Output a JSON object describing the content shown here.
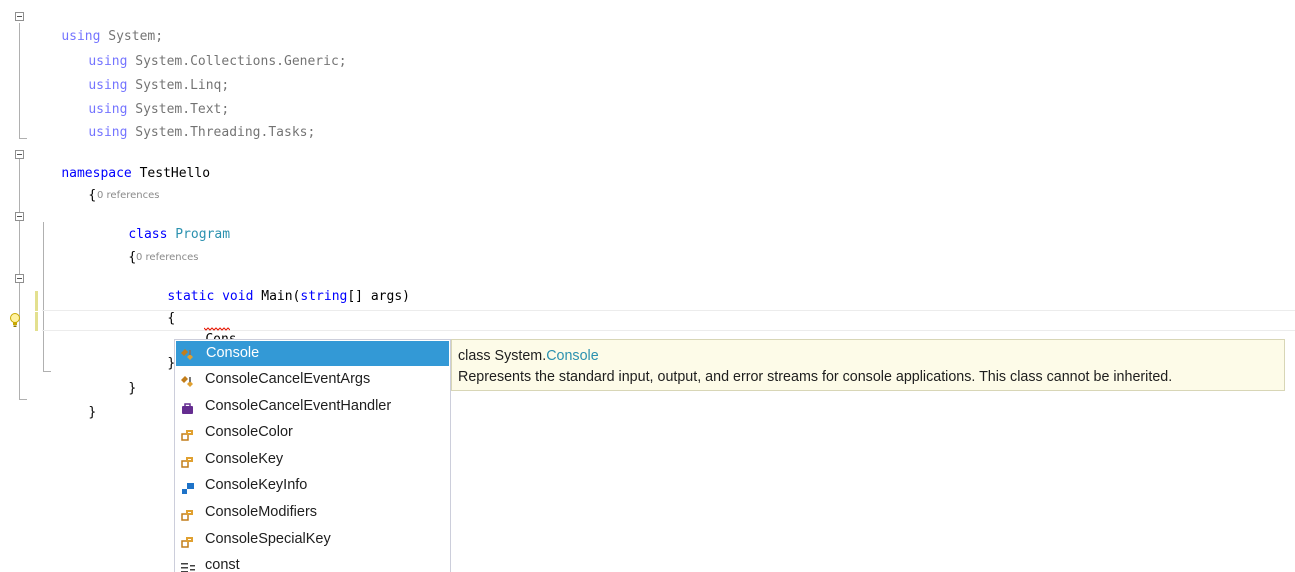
{
  "code": {
    "using1_kw": "using",
    "using1_ns": " System;",
    "using2_kw": "using",
    "using2_ns": " System.Collections.Generic;",
    "using3_kw": "using",
    "using3_ns": " System.Linq;",
    "using4_kw": "using",
    "using4_ns": " System.Text;",
    "using5_kw": "using",
    "using5_ns": " System.Threading.Tasks;",
    "ns_kw": "namespace",
    "ns_name": " TestHello",
    "open_brace": "{",
    "close_brace": "}",
    "class_kw": "class",
    "class_name": " Program",
    "static_kw": "static",
    "void_kw": " void",
    "main_sig1": " Main(",
    "string_kw": "string",
    "main_sig2": "[] args)",
    "typed_text": "Cons"
  },
  "codelens": {
    "class_refs": "0 references",
    "method_refs": "0 references"
  },
  "completion": {
    "items": [
      {
        "label": "Console",
        "icon": "class-icon",
        "selected": true
      },
      {
        "label": "ConsoleCancelEventArgs",
        "icon": "class-icon"
      },
      {
        "label": "ConsoleCancelEventHandler",
        "icon": "delegate-icon"
      },
      {
        "label": "ConsoleColor",
        "icon": "enum-icon"
      },
      {
        "label": "ConsoleKey",
        "icon": "enum-icon"
      },
      {
        "label": "ConsoleKeyInfo",
        "icon": "struct-icon"
      },
      {
        "label": "ConsoleModifiers",
        "icon": "enum-icon"
      },
      {
        "label": "ConsoleSpecialKey",
        "icon": "enum-icon"
      },
      {
        "label": "const",
        "icon": "keyword-icon"
      }
    ]
  },
  "tooltip": {
    "kind": "class ",
    "namespace": "System.",
    "type_name": "Console",
    "description": "Represents the standard input, output, and error streams for console applications. This class cannot be inherited."
  },
  "colors": {
    "keyword": "#0000ff",
    "type": "#2b91af",
    "selection": "#3399d6",
    "tooltip_bg": "#fdfbe8"
  }
}
